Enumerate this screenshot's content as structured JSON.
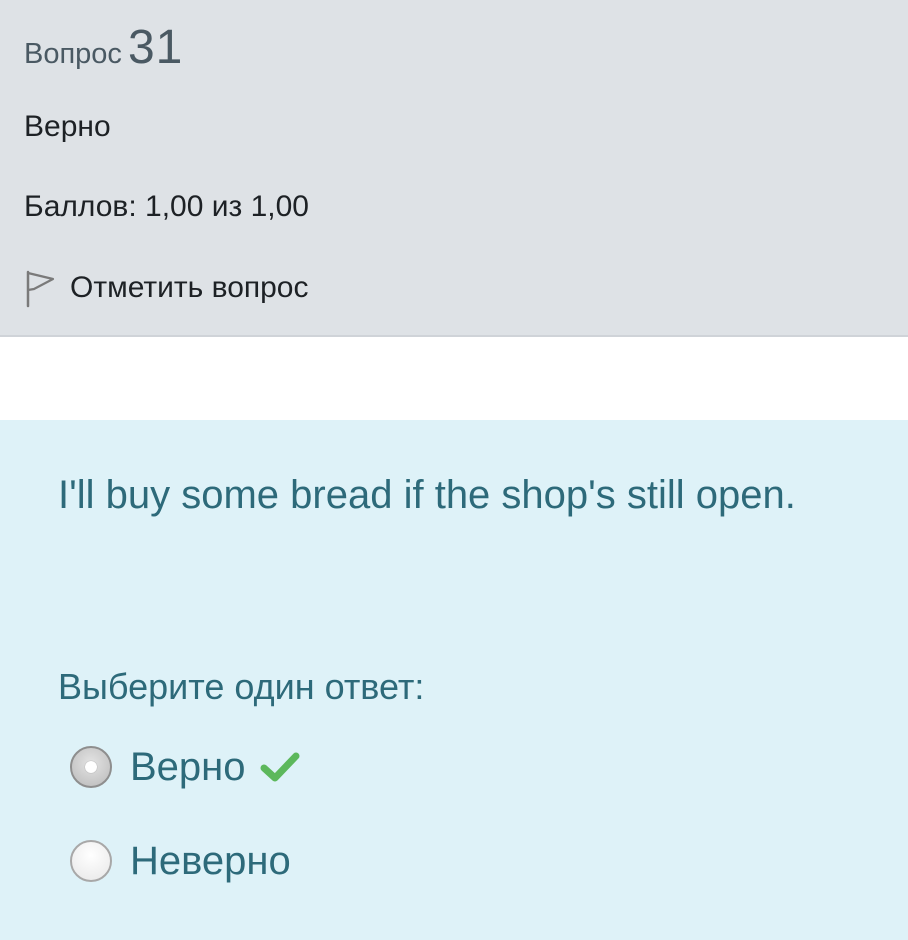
{
  "question": {
    "label": "Вопрос",
    "number": "31",
    "state": "Верно",
    "grade": "Баллов: 1,00 из 1,00",
    "flag_label": "Отметить вопрос",
    "flag_icon": "flag-outline-icon"
  },
  "content": {
    "text": "I'll buy some bread if the shop's still open.",
    "prompt": "Выберите один ответ:",
    "options": [
      {
        "label": "Верно",
        "selected": true,
        "marked_correct": true,
        "icon": "check-icon"
      },
      {
        "label": "Неверно",
        "selected": false
      }
    ]
  },
  "colors": {
    "info_bg": "#dee2e6",
    "content_bg": "#def2f8",
    "content_text": "#2d6a7a",
    "correct_green": "#5cb85c"
  }
}
